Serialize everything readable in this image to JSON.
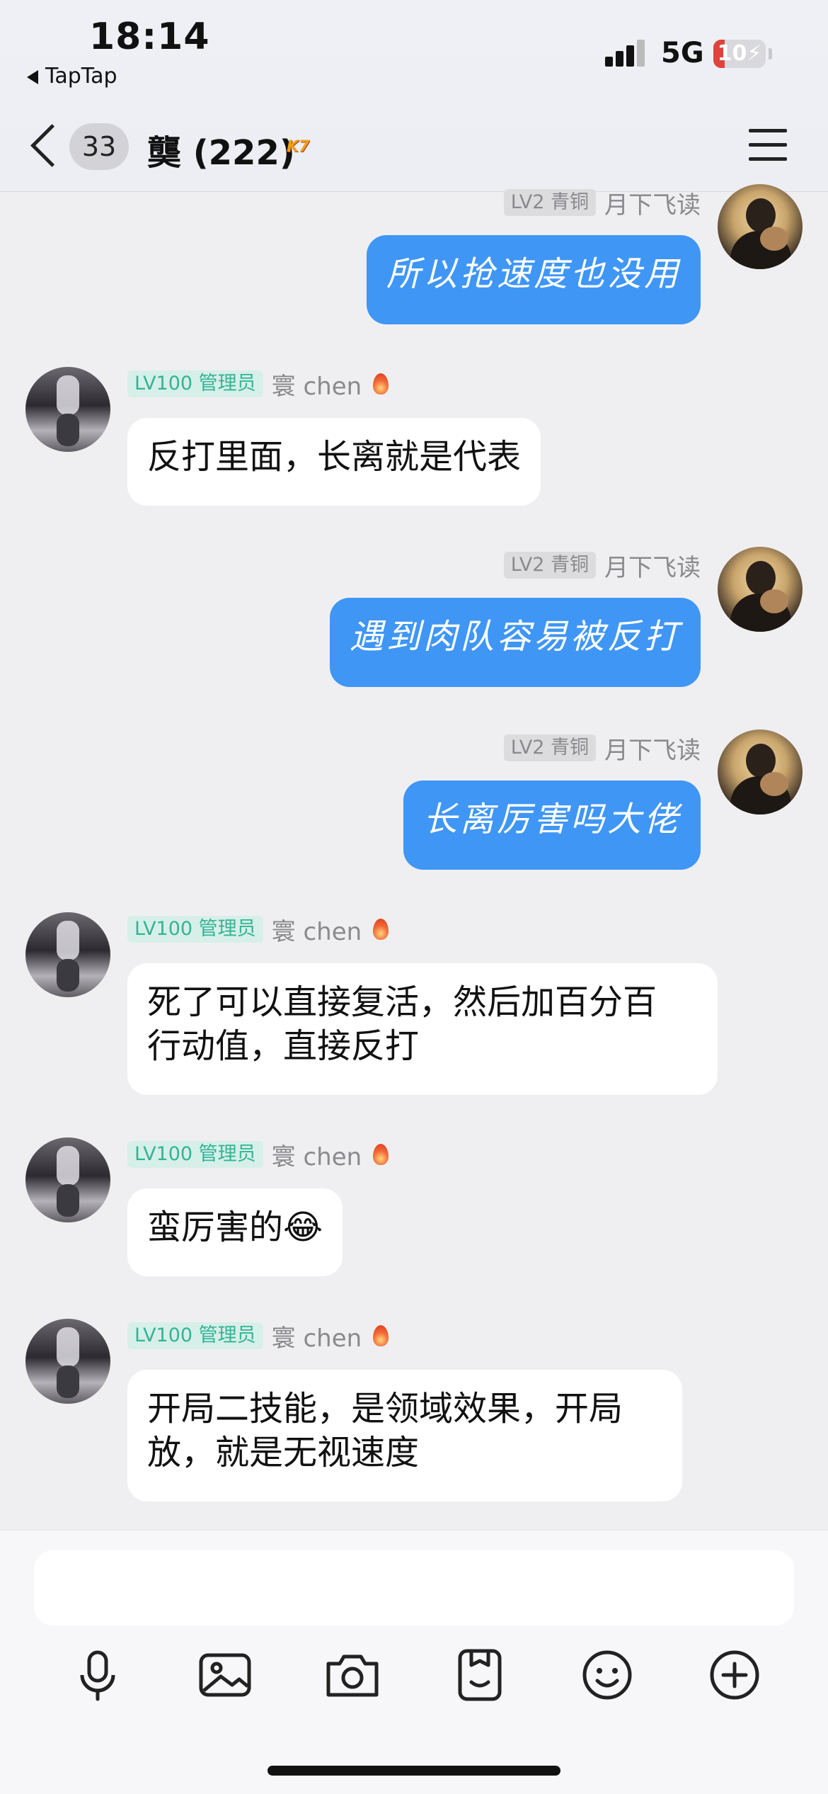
{
  "status_bar": {
    "time": "18:14",
    "back_app": "TapTap",
    "network": "5G",
    "battery_percent": 10,
    "battery_label": "10"
  },
  "header": {
    "unread_count": "33",
    "title": "龑 (222)",
    "group_tag": "K7"
  },
  "messages": [
    {
      "side": "out",
      "level": "LV2 青铜",
      "name": "月下飞读",
      "text": "所以抢速度也没用"
    },
    {
      "side": "in",
      "level": "LV100 管理员",
      "name": "寰 chen",
      "text": "反打里面，长离就是代表"
    },
    {
      "side": "out",
      "level": "LV2 青铜",
      "name": "月下飞读",
      "text": "遇到肉队容易被反打"
    },
    {
      "side": "out",
      "level": "LV2 青铜",
      "name": "月下飞读",
      "text": "长离厉害吗大佬"
    },
    {
      "side": "in",
      "level": "LV100 管理员",
      "name": "寰 chen",
      "text_line1": "死了可以直接复活，然后加百分百",
      "text_line2": "行动值，直接反打"
    },
    {
      "side": "in",
      "level": "LV100 管理员",
      "name": "寰 chen",
      "text": "蛮厉害的😂"
    },
    {
      "side": "in",
      "level": "LV100 管理员",
      "name": "寰 chen",
      "text_line1": "开局二技能，是领域效果，开局",
      "text_line2": "放，就是无视速度"
    }
  ],
  "toolbar": {
    "icons": [
      "microphone-icon",
      "image-icon",
      "camera-icon",
      "sticker-icon",
      "emoji-icon",
      "plus-icon"
    ]
  },
  "colors": {
    "accent": "#3f96f5",
    "admin_green": "#33b495",
    "background": "#efeff1"
  }
}
